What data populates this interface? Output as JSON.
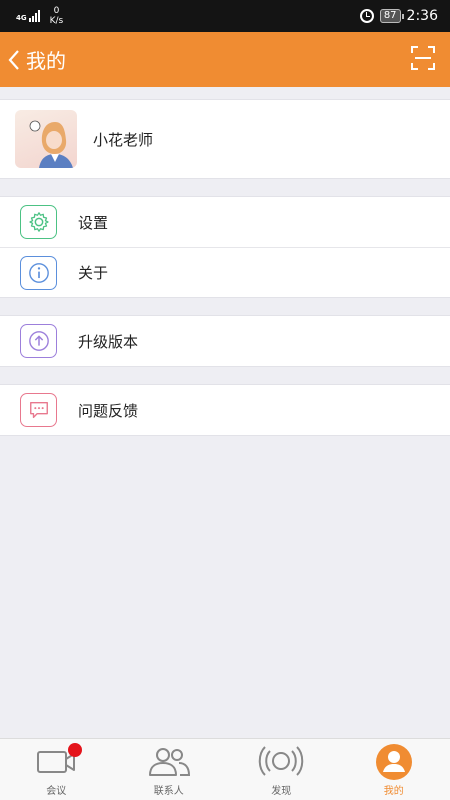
{
  "status_bar": {
    "network": "4G",
    "speed_value": "0",
    "speed_unit": "K/s",
    "battery": "87",
    "time": "2:36"
  },
  "header": {
    "title": "我的"
  },
  "profile": {
    "name": "小花老师"
  },
  "menu": {
    "settings": "设置",
    "about": "关于",
    "upgrade": "升级版本",
    "feedback": "问题反馈"
  },
  "tabs": [
    {
      "label": "会议"
    },
    {
      "label": "联系人"
    },
    {
      "label": "发现"
    },
    {
      "label": "我的"
    }
  ],
  "colors": {
    "accent": "#f08c32",
    "badge": "#e4141b"
  }
}
